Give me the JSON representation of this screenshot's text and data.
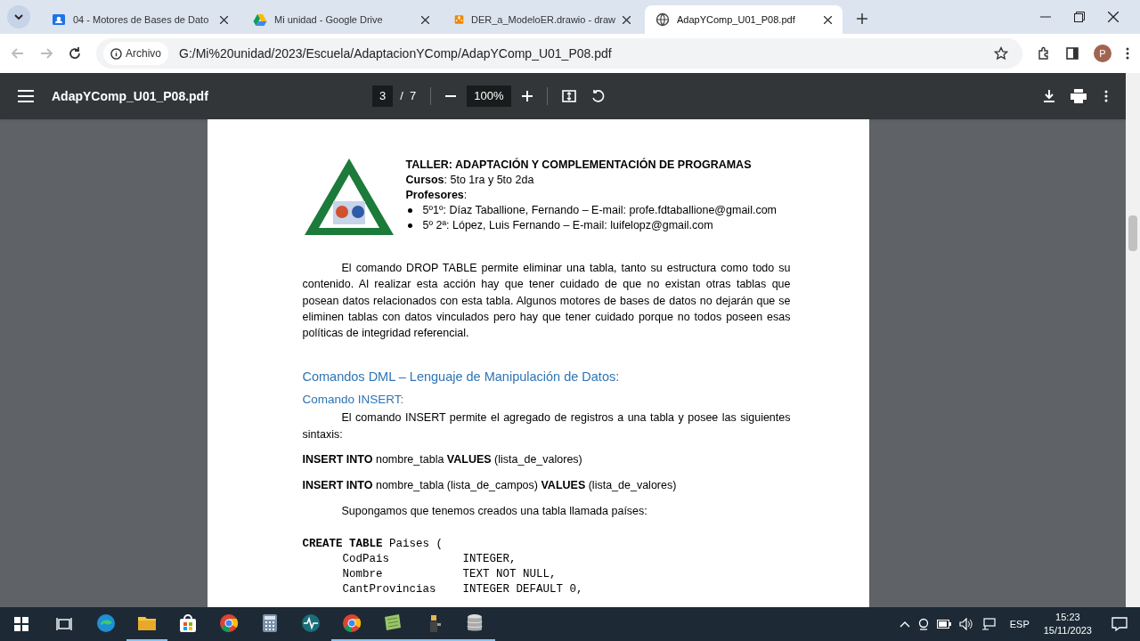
{
  "tabs": [
    {
      "title": "04 - Motores de Bases de Dato",
      "kind": "classroom",
      "selected": false
    },
    {
      "title": "Mi unidad - Google Drive",
      "kind": "drive",
      "selected": false
    },
    {
      "title": "DER_a_ModeloER.drawio - draw",
      "kind": "drawio",
      "selected": false
    },
    {
      "title": "AdapYComp_U01_P08.pdf",
      "kind": "globe",
      "selected": true
    }
  ],
  "address_bar": {
    "chip": "Archivo",
    "url": "G:/Mi%20unidad/2023/Escuela/AdaptacionYComp/AdapYComp_U01_P08.pdf",
    "avatar": "P"
  },
  "pdf_toolbar": {
    "title": "AdapYComp_U01_P08.pdf",
    "page": "3",
    "total": "/  7",
    "zoom": "100%"
  },
  "document": {
    "header": {
      "title": "TALLER: ADAPTACIÓN Y COMPLEMENTACIÓN DE PROGRAMAS",
      "lines": [
        "**Cursos**: 5to 1ra y 5to 2da",
        "**Profesores**:"
      ],
      "bullets": [
        "5º1º: Díaz Taballione, Fernando – E-mail: profe.fdtaballione@gmail.com",
        "5º 2ª: López, Luis Fernando – E-mail: luifelopz@gmail.com"
      ]
    },
    "blocks": [
      {
        "kind": "paragraph",
        "text": "El comando DROP TABLE permite eliminar una tabla, tanto su estructura como todo su contenido. Al realizar esta acción hay que tener cuidado de que no existan otras tablas que posean datos relacionados con esta tabla. Algunos motores de bases de datos no dejarán que se eliminen tablas con datos vinculados pero hay que tener cuidado porque no todos poseen esas políticas de integridad referencial."
      },
      {
        "kind": "heading",
        "text": "Comandos DML – Lenguaje de Manipulación de Datos:"
      },
      {
        "kind": "subheading",
        "text": "Comando INSERT:"
      },
      {
        "kind": "paragraph",
        "text": "El comando INSERT permite el agregado de registros a una tabla y posee las siguientes sintaxis:"
      },
      {
        "kind": "syntax",
        "text": "**INSERT INTO** nombre_tabla **VALUES** (lista_de_valores)"
      },
      {
        "kind": "syntax",
        "text": "**INSERT INTO** nombre_tabla (lista_de_campos) **VALUES** (lista_de_valores)"
      },
      {
        "kind": "paragraph",
        "text": "Supongamos que tenemos creados una tabla llamada países:"
      },
      {
        "kind": "code",
        "text": "**CREATE TABLE** Paises (\n      CodPais           INTEGER,\n      Nombre            TEXT NOT NULL,\n      CantProvincias    INTEGER DEFAULT 0,"
      }
    ]
  },
  "taskbar": {
    "apps": [
      {
        "kind": "edge",
        "running": false
      },
      {
        "kind": "folder",
        "running": true
      },
      {
        "kind": "store",
        "running": false
      },
      {
        "kind": "chrome",
        "running": false
      },
      {
        "kind": "calculator",
        "running": false
      },
      {
        "kind": "wave",
        "running": false
      },
      {
        "kind": "chrome",
        "running": true
      },
      {
        "kind": "sheet",
        "running": true
      },
      {
        "kind": "figure",
        "running": true
      },
      {
        "kind": "database",
        "running": true
      }
    ],
    "language": "ESP",
    "time": "15:23",
    "date": "15/11/2023"
  }
}
